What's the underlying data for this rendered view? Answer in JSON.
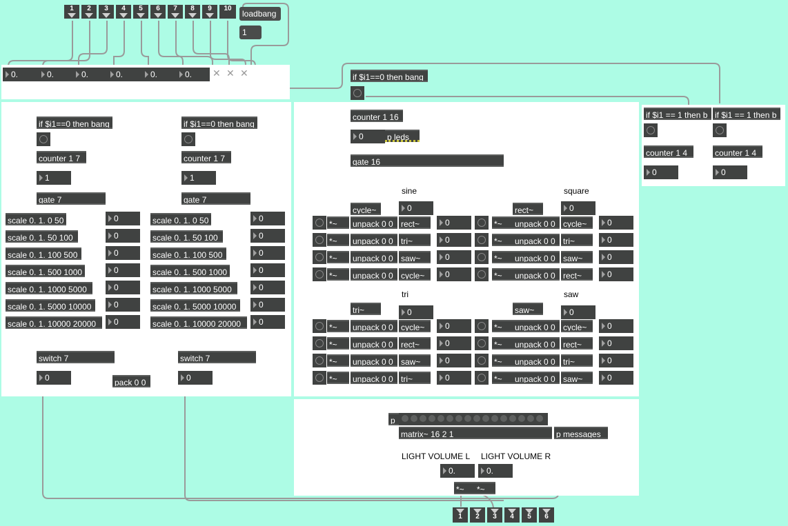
{
  "inlets": [
    "1",
    "2",
    "3",
    "4",
    "5",
    "6",
    "7",
    "8",
    "9",
    "10"
  ],
  "outlets": [
    "1",
    "2",
    "3",
    "4",
    "5",
    "6"
  ],
  "top": {
    "loadbang": "loadbang",
    "msg_one": "1",
    "floats": [
      "0.",
      "0.",
      "0.",
      "0.",
      "0.",
      "0."
    ]
  },
  "condA": {
    "ifbang": "if $i1==0 then bang"
  },
  "left": {
    "col1": {
      "ifbang": "if $i1==0 then bang",
      "counter": "counter 1 7",
      "counter_num": "1",
      "gate": "gate 7",
      "switch": "switch 7",
      "switch_num": "0"
    },
    "col2": {
      "ifbang": "if $i1==0 then bang",
      "counter": "counter 1 7",
      "counter_num": "1",
      "gate": "gate 7",
      "switch": "switch 7",
      "switch_num": "0"
    },
    "scales": [
      "scale 0. 1. 0 50",
      "scale 0. 1. 50 100",
      "scale 0. 1. 100 500",
      "scale 0. 1. 500 1000",
      "scale 0. 1. 1000 5000",
      "scale 0. 1. 5000 10000",
      "scale 0. 1. 10000 20000"
    ],
    "scale_nums": [
      "0",
      "0",
      "0",
      "0",
      "0",
      "0",
      "0"
    ],
    "pack": "pack 0 0"
  },
  "middle": {
    "counter": "counter 1 16",
    "counter_num": "0",
    "pleds": "p leds",
    "gate": "gate 16",
    "q1": {
      "label": "sine",
      "osc": "cycle~",
      "num": "0",
      "rows": [
        {
          "mul": "*~",
          "unpack": "unpack 0 0",
          "osc": "rect~",
          "num": "0"
        },
        {
          "mul": "*~",
          "unpack": "unpack 0 0",
          "osc": "tri~",
          "num": "0"
        },
        {
          "mul": "*~",
          "unpack": "unpack 0 0",
          "osc": "saw~",
          "num": "0"
        },
        {
          "mul": "*~",
          "unpack": "unpack 0 0",
          "osc": "cycle~",
          "num": "0"
        }
      ]
    },
    "q2": {
      "label": "square",
      "osc": "rect~",
      "num": "0",
      "rows": [
        {
          "mul": "*~",
          "unpack": "unpack 0 0",
          "osc": "cycle~",
          "num": "0"
        },
        {
          "mul": "*~",
          "unpack": "unpack 0 0",
          "osc": "tri~",
          "num": "0"
        },
        {
          "mul": "*~",
          "unpack": "unpack 0 0",
          "osc": "saw~",
          "num": "0"
        },
        {
          "mul": "*~",
          "unpack": "unpack 0 0",
          "osc": "rect~",
          "num": "0"
        }
      ]
    },
    "q3": {
      "label": "tri",
      "osc": "tri~",
      "num": "0",
      "rows": [
        {
          "mul": "*~",
          "unpack": "unpack 0 0",
          "osc": "cycle~",
          "num": "0"
        },
        {
          "mul": "*~",
          "unpack": "unpack 0 0",
          "osc": "rect~",
          "num": "0"
        },
        {
          "mul": "*~",
          "unpack": "unpack 0 0",
          "osc": "saw~",
          "num": "0"
        },
        {
          "mul": "*~",
          "unpack": "unpack 0 0",
          "osc": "tri~",
          "num": "0"
        }
      ]
    },
    "q4": {
      "label": "saw",
      "osc": "saw~",
      "num": "0",
      "rows": [
        {
          "mul": "*~",
          "unpack": "unpack 0 0",
          "osc": "cycle~",
          "num": "0"
        },
        {
          "mul": "*~",
          "unpack": "unpack 0 0",
          "osc": "rect~",
          "num": "0"
        },
        {
          "mul": "*~",
          "unpack": "unpack 0 0",
          "osc": "tri~",
          "num": "0"
        },
        {
          "mul": "*~",
          "unpack": "unpack 0 0",
          "osc": "saw~",
          "num": "0"
        }
      ]
    }
  },
  "right": {
    "c1": {
      "ifbang": "if $i1 == 1 then b",
      "counter": "counter 1 4",
      "num": "0"
    },
    "c2": {
      "ifbang": "if $i1 == 1 then b",
      "counter": "counter 1 4",
      "num": "0"
    }
  },
  "bottom": {
    "p": "p",
    "matrix": "matrix~ 16 2 1",
    "pmessages": "p messages",
    "light_l": "LIGHT VOLUME L",
    "light_r": "LIGHT VOLUME R",
    "vol_l": "0.",
    "vol_r": "0.",
    "mul_l": "*~",
    "mul_r": "*~"
  }
}
